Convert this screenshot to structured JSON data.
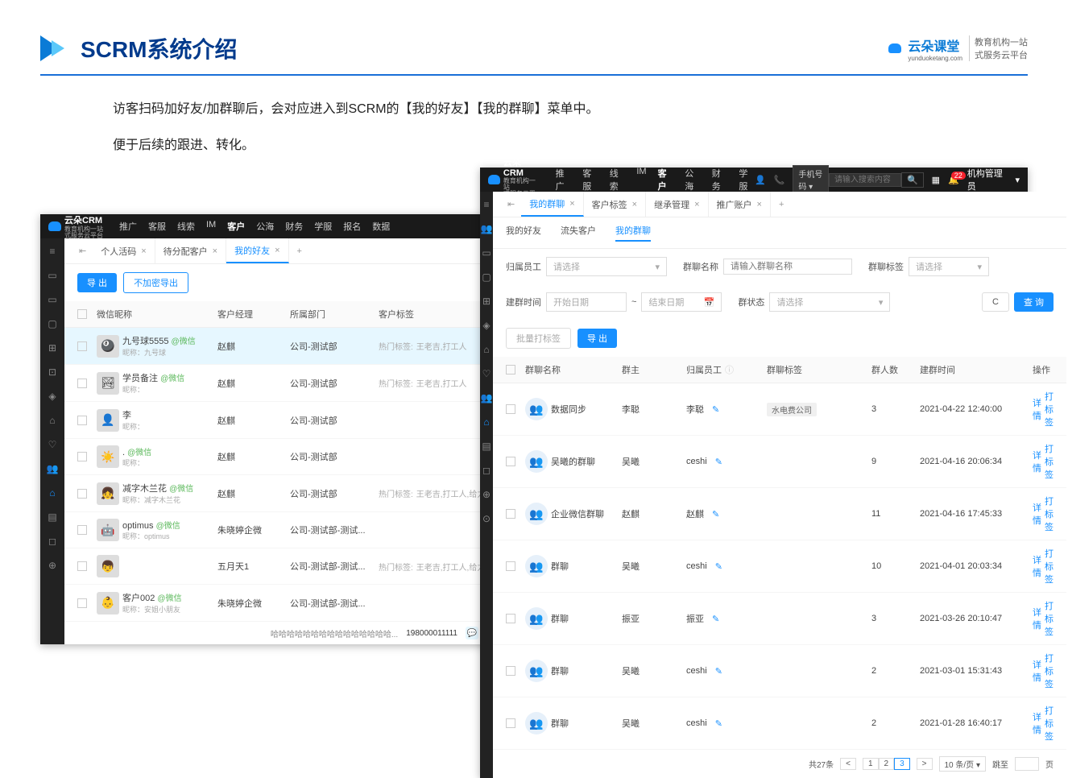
{
  "slide": {
    "title": "SCRM系统介绍",
    "logo_right_brand": "云朵课堂",
    "logo_right_sub": "yunduoketang.com",
    "logo_right_desc": "教育机构一站\n式服务云平台",
    "intro1": "访客扫码加好友/加群聊后，会对应进入到SCRM的【我的好友】【我的群聊】菜单中。",
    "intro2": "便于后续的跟进、转化。"
  },
  "left": {
    "logo": "云朵CRM",
    "logo_sub": "教育机构一站\n式服务云平台",
    "nav": [
      "推广",
      "客服",
      "线索",
      "IM",
      "客户",
      "公海",
      "财务",
      "学服",
      "报名",
      "数据"
    ],
    "nav_active": "客户",
    "tabs": [
      {
        "label": "个人活码",
        "closable": true
      },
      {
        "label": "待分配客户",
        "closable": true
      },
      {
        "label": "我的好友",
        "closable": true,
        "active": true
      }
    ],
    "tab_add": "+",
    "btn_export": "导 出",
    "btn_noenc_export": "不加密导出",
    "columns": {
      "name": "微信昵称",
      "mgr": "客户经理",
      "dept": "所属部门",
      "tag": "客户标签"
    },
    "hot_prefix": "热门标签:",
    "rows": [
      {
        "avatar": "🎱",
        "name": "九号球5555",
        "wx": "@微信",
        "sub": "昵称：九号球",
        "mgr": "赵麒",
        "dept": "公司-测试部",
        "hot": "王老吉,打工人",
        "selected": true
      },
      {
        "avatar": "🏞",
        "name": "学员备注",
        "wx": "@微信",
        "sub": "昵称：",
        "mgr": "赵麒",
        "dept": "公司-测试部",
        "hot": "王老吉,打工人"
      },
      {
        "avatar": "👤",
        "name": "李",
        "wx": "",
        "sub": "昵称：",
        "mgr": "赵麒",
        "dept": "公司-测试部",
        "hot": ""
      },
      {
        "avatar": "☀️",
        "name": ".",
        "wx": "@微信",
        "sub": "昵称：",
        "mgr": "赵麒",
        "dept": "公司-测试部",
        "hot": ""
      },
      {
        "avatar": "👧",
        "name": "减字木兰花",
        "wx": "@微信",
        "sub": "昵称：减字木兰花",
        "mgr": "赵麒",
        "dept": "公司-测试部",
        "hot": "王老吉,打工人,给力,康..."
      },
      {
        "avatar": "🤖",
        "name": "optimus",
        "wx": "@微信",
        "sub": "昵称：optimus",
        "mgr": "朱晓婷企微",
        "dept": "公司-测试部-测试...",
        "hot": ""
      },
      {
        "avatar": "👦",
        "name": "",
        "wx": "",
        "sub": "",
        "mgr": "五月天1",
        "dept": "公司-测试部-测试...",
        "hot": "王老吉,打工人,给力,康..."
      },
      {
        "avatar": "👶",
        "name": "客户002",
        "wx": "@微信",
        "sub": "昵称：安姐小朋友",
        "mgr": "朱晓婷企微",
        "dept": "公司-测试部-测试...",
        "hot": ""
      }
    ],
    "bottom_note": "哈哈哈哈哈哈哈哈哈哈哈哈哈哈哈...",
    "phone": "198000011111"
  },
  "right": {
    "logo": "云朵CRM",
    "logo_sub": "教育机构一站\n式服务云平台",
    "nav": [
      "推广",
      "客服",
      "线索",
      "IM",
      "客户",
      "公海",
      "财务",
      "学服"
    ],
    "nav_active": "客户",
    "search_sel": "手机号码",
    "search_ph": "请输入搜索内容",
    "role": "机构管理员",
    "notif_badge": "22",
    "tabs": [
      {
        "label": "我的群聊",
        "closable": true,
        "active": true
      },
      {
        "label": "客户标签",
        "closable": true
      },
      {
        "label": "继承管理",
        "closable": true
      },
      {
        "label": "推广账户",
        "closable": true
      }
    ],
    "subtabs": [
      "我的好友",
      "流失客户",
      "我的群聊"
    ],
    "subtab_active": "我的群聊",
    "filters": {
      "emp_label": "归属员工",
      "emp_ph": "请选择",
      "name_label": "群聊名称",
      "name_ph": "请输入群聊名称",
      "tag_label": "群聊标签",
      "tag_ph": "请选择",
      "time_label": "建群时间",
      "start_ph": "开始日期",
      "end_ph": "结束日期",
      "status_label": "群状态",
      "status_ph": "请选择"
    },
    "btn_reset": "C",
    "btn_search": "查 询",
    "btn_batch": "批量打标签",
    "btn_export": "导 出",
    "columns": {
      "name": "群聊名称",
      "owner": "群主",
      "emp": "归属员工",
      "tag": "群聊标签",
      "count": "群人数",
      "time": "建群时间",
      "op": "操作"
    },
    "op_detail": "详情",
    "op_tag": "打标签",
    "rows": [
      {
        "name": "数据同步",
        "owner": "李聪",
        "emp": "李聪",
        "tag": "水电费公司",
        "count": "3",
        "time": "2021-04-22 12:40:00"
      },
      {
        "name": "吴曦的群聊",
        "owner": "吴曦",
        "emp": "ceshi",
        "tag": "",
        "count": "9",
        "time": "2021-04-16 20:06:34"
      },
      {
        "name": "企业微信群聊",
        "owner": "赵麒",
        "emp": "赵麒",
        "tag": "",
        "count": "11",
        "time": "2021-04-16 17:45:33"
      },
      {
        "name": "群聊",
        "owner": "吴曦",
        "emp": "ceshi",
        "tag": "",
        "count": "10",
        "time": "2021-04-01 20:03:34"
      },
      {
        "name": "群聊",
        "owner": "振亚",
        "emp": "振亚",
        "tag": "",
        "count": "3",
        "time": "2021-03-26 20:10:47"
      },
      {
        "name": "群聊",
        "owner": "吴曦",
        "emp": "ceshi",
        "tag": "",
        "count": "2",
        "time": "2021-03-01 15:31:43"
      },
      {
        "name": "群聊",
        "owner": "吴曦",
        "emp": "ceshi",
        "tag": "",
        "count": "2",
        "time": "2021-01-28 16:40:17"
      }
    ],
    "pagination": {
      "total": "共27条",
      "prev": "<",
      "pages": [
        "1",
        "2",
        "3"
      ],
      "active": "3",
      "next": ">",
      "size": "10 条/页",
      "goto": "跳至",
      "page_suffix": "页"
    }
  }
}
